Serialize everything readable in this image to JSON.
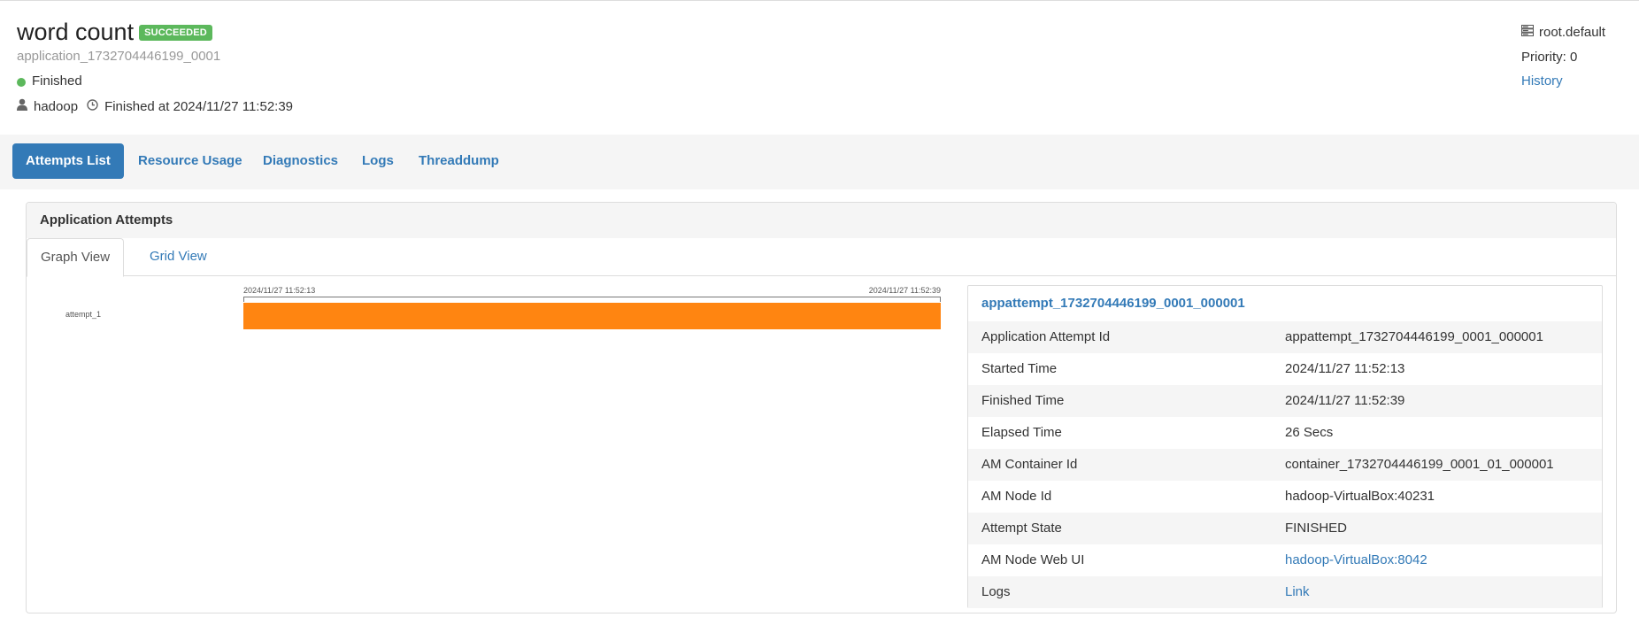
{
  "app": {
    "title": "word count",
    "status_badge": "SUCCEEDED",
    "id": "application_1732704446199_0001",
    "state": "Finished",
    "user": "hadoop",
    "finished_at": "Finished at 2024/11/27 11:52:39",
    "queue": "root.default",
    "priority": "Priority: 0",
    "history_link": "History"
  },
  "nav": {
    "tabs": [
      {
        "label": "Attempts List",
        "active": true
      },
      {
        "label": "Resource Usage"
      },
      {
        "label": "Diagnostics"
      },
      {
        "label": "Logs"
      },
      {
        "label": "Threaddump"
      }
    ]
  },
  "panel": {
    "heading": "Application Attempts",
    "tabs": [
      {
        "label": "Graph View",
        "active": true
      },
      {
        "label": "Grid View"
      }
    ]
  },
  "timeline": {
    "start_label": "2024/11/27 11:52:13",
    "end_label": "2024/11/27 11:52:39",
    "rows": [
      {
        "label": "attempt_1",
        "start": "2024/11/27 11:52:13",
        "end": "2024/11/27 11:52:39"
      }
    ],
    "bar_color": "#ff8511"
  },
  "details": {
    "title": "appattempt_1732704446199_0001_000001",
    "rows": [
      {
        "key": "Application Attempt Id",
        "value": "appattempt_1732704446199_0001_000001"
      },
      {
        "key": "Started Time",
        "value": "2024/11/27 11:52:13"
      },
      {
        "key": "Finished Time",
        "value": "2024/11/27 11:52:39"
      },
      {
        "key": "Elapsed Time",
        "value": "26 Secs"
      },
      {
        "key": "AM Container Id",
        "value": "container_1732704446199_0001_01_000001"
      },
      {
        "key": "AM Node Id",
        "value": "hadoop-VirtualBox:40231"
      },
      {
        "key": "Attempt State",
        "value": "FINISHED"
      },
      {
        "key": "AM Node Web UI",
        "value": "hadoop-VirtualBox:8042"
      },
      {
        "key": "Logs",
        "value": "Link"
      }
    ]
  },
  "colors": {
    "primary": "#337ab7",
    "success": "#5cb85c",
    "bar": "#ff8511"
  }
}
